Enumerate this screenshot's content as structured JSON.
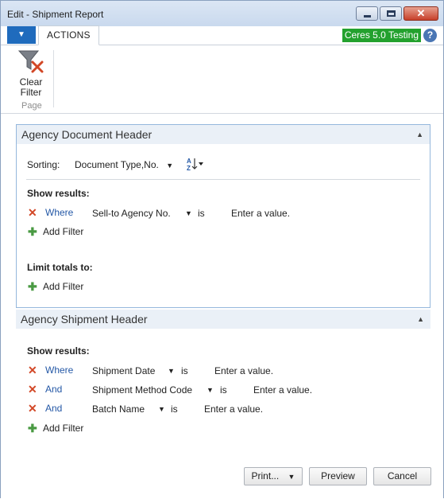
{
  "window": {
    "title": "Edit - Shipment Report",
    "close_glyph": "✕"
  },
  "ribbon": {
    "menu_icon": "▼",
    "tab_actions": "ACTIONS",
    "environment_badge": "Ceres 5.0 Testing",
    "help_glyph": "?",
    "clear_filter_line1": "Clear",
    "clear_filter_line2": "Filter",
    "group_label": "Page"
  },
  "section1": {
    "title": "Agency Document Header",
    "collapse_glyph": "▲",
    "sorting_label": "Sorting:",
    "sorting_value": "Document Type,No.",
    "sort_icon_text": "A↓Z",
    "show_results_label": "Show results:",
    "filters": [
      {
        "connector": "Where",
        "field": "Sell-to Agency No.",
        "operator": "is",
        "value": "Enter a value."
      }
    ],
    "add_filter_label": "Add Filter",
    "limit_totals_label": "Limit totals to:",
    "limit_add_filter_label": "Add Filter"
  },
  "section2": {
    "title": "Agency Shipment Header",
    "collapse_glyph": "▲",
    "show_results_label": "Show results:",
    "filters": [
      {
        "connector": "Where",
        "field": "Shipment Date",
        "operator": "is",
        "value": "Enter a value."
      },
      {
        "connector": "And",
        "field": "Shipment Method Code",
        "operator": "is",
        "value": "Enter a value."
      },
      {
        "connector": "And",
        "field": "Batch Name",
        "operator": "is",
        "value": "Enter a value."
      }
    ],
    "add_filter_label": "Add Filter"
  },
  "footer": {
    "print_label": "Print...",
    "preview_label": "Preview",
    "cancel_label": "Cancel"
  },
  "glyphs": {
    "remove": "✕",
    "add": "✚",
    "dropdown": "▼"
  },
  "colors": {
    "environment_badge": "#23a12e",
    "remove_icon": "#d24726",
    "add_icon": "#4a9a43",
    "link": "#2458a6"
  }
}
